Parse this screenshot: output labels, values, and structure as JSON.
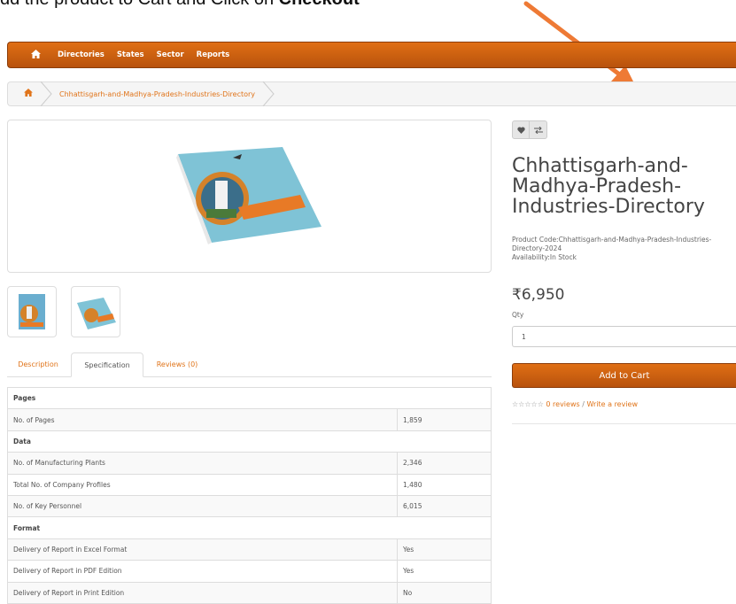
{
  "instruction": {
    "prefix": "dd the product to Cart and Click on ",
    "bold": "Checkout"
  },
  "nav": {
    "items": [
      "Directories",
      "States",
      "Sector",
      "Reports"
    ]
  },
  "breadcrumb": {
    "item": "Chhattisgarh-and-Madhya-Pradesh-Industries-Directory"
  },
  "tabs": [
    "Description",
    "Specification",
    "Reviews (0)"
  ],
  "spec": {
    "pages_header": "Pages",
    "pages_label": "No. of Pages",
    "pages_value": "1,859",
    "data_header": "Data",
    "plants_label": "No. of Manufacturing Plants",
    "plants_value": "2,346",
    "profiles_label": "Total No. of Company Profiles",
    "profiles_value": "1,480",
    "personnel_label": "No. of Key Personnel",
    "personnel_value": "6,015",
    "format_header": "Format",
    "excel_label": "Delivery of Report in Excel Format",
    "excel_value": "Yes",
    "pdf_label": "Delivery of Report in PDF Edition",
    "pdf_value": "Yes",
    "print_label": "Delivery of Report in Print Edition",
    "print_value": "No"
  },
  "product": {
    "title": "Chhattisgarh-and-Madhya-Pradesh-Industries-Directory",
    "code_label": "Product Code:",
    "code": "Chhattisgarh-and-Madhya-Pradesh-Industries-Directory-2024",
    "availability_label": "Availability:",
    "availability": "In Stock",
    "price": "₹6,950",
    "qty_label": "Qty",
    "qty_value": "1",
    "add_to_cart": "Add to Cart",
    "reviews_link": "0 reviews",
    "review_sep": " / ",
    "write_review": "Write a review"
  },
  "colors": {
    "accent": "#e0741a",
    "nav_bg": "#c85f10",
    "arrow": "#ee7a35"
  },
  "icons": [
    "home-icon",
    "heart-icon",
    "compare-icon",
    "star-icon",
    "arrow-annotation"
  ]
}
